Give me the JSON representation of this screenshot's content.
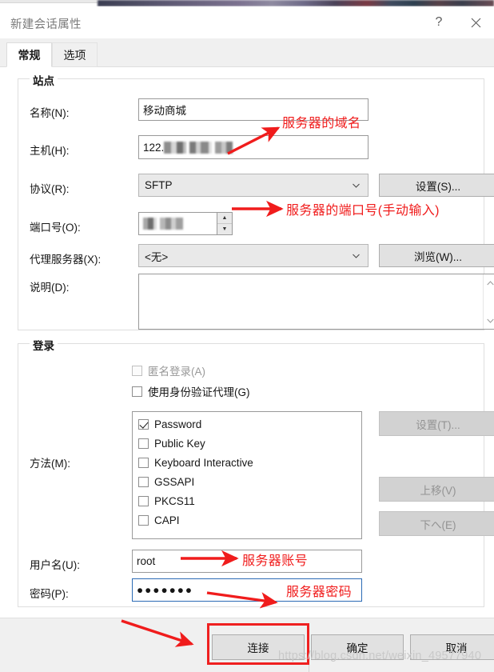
{
  "window": {
    "title": "新建会话属性",
    "help_label": "?",
    "close_label": "✕"
  },
  "tabs": [
    {
      "label": "常规",
      "active": true
    },
    {
      "label": "选项",
      "active": false
    }
  ],
  "site_group": {
    "title": "站点",
    "fields": {
      "name_label": "名称(N):",
      "name_value": "移动商城",
      "host_label": "主机(H):",
      "host_value": "122.",
      "protocol_label": "协议(R):",
      "protocol_value": "SFTP",
      "protocol_settings_button": "设置(S)...",
      "port_label": "端口号(O):",
      "port_value": "",
      "proxy_label": "代理服务器(X):",
      "proxy_value": "<无>",
      "proxy_browse_button": "浏览(W)...",
      "desc_label": "说明(D):",
      "desc_value": ""
    }
  },
  "login_group": {
    "title": "登录",
    "anonymous_label": "匿名登录(A)",
    "anonymous_checked": false,
    "anonymous_disabled": true,
    "agent_label": "使用身份验证代理(G)",
    "agent_checked": false,
    "method_label": "方法(M):",
    "methods": [
      {
        "label": "Password",
        "checked": true
      },
      {
        "label": "Public Key",
        "checked": false
      },
      {
        "label": "Keyboard Interactive",
        "checked": false
      },
      {
        "label": "GSSAPI",
        "checked": false
      },
      {
        "label": "PKCS11",
        "checked": false
      },
      {
        "label": "CAPI",
        "checked": false
      }
    ],
    "side_buttons": [
      {
        "label": "设置(T)...",
        "disabled": true
      },
      {
        "label": "上移(V)",
        "disabled": true
      },
      {
        "label": "下へ(E)",
        "disabled": true
      }
    ],
    "username_label": "用户名(U):",
    "username_value": "root",
    "password_label": "密码(P):",
    "password_value": "●●●●●●●"
  },
  "footer": {
    "connect_label": "连接",
    "ok_label": "确定",
    "cancel_label": "取消"
  },
  "annotations": [
    {
      "id": "domain",
      "text": "服务器的域名"
    },
    {
      "id": "port",
      "text": "服务器的端口号(手动输入)"
    },
    {
      "id": "user",
      "text": "服务器账号"
    },
    {
      "id": "pass",
      "text": "服务器密码"
    }
  ],
  "watermark": "https://blog.csdn.net/weixin_49577940",
  "colors": {
    "annotation_red": "#f01c1c",
    "highlight_red": "#ef2020",
    "focus_blue": "#2b6bb5",
    "dialog_bg": "#ffffff",
    "chrome_bg": "#f0f0f0"
  }
}
